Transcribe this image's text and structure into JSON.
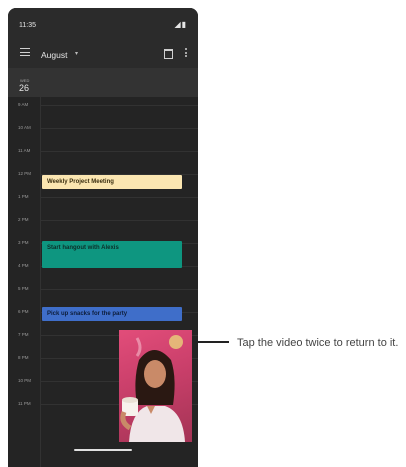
{
  "status_bar": {
    "time": "11:35",
    "icons": "◢▮"
  },
  "app_bar": {
    "month": "August",
    "caret": "▾"
  },
  "day_header": {
    "day_name": "WED",
    "day_number": "26"
  },
  "hours": [
    "9 AM",
    "10 AM",
    "11 AM",
    "12 PM",
    "1 PM",
    "2 PM",
    "3 PM",
    "4 PM",
    "5 PM",
    "6 PM",
    "7 PM",
    "8 PM",
    "10 PM",
    "11 PM"
  ],
  "events": [
    {
      "title": "Weekly Project Meeting",
      "color": "#fbe6b1",
      "text_color": "#3b2f10"
    },
    {
      "title": "Start hangout with Alexis",
      "color": "#0e9680",
      "text_color": "#0b2f29"
    },
    {
      "title": "Pick up snacks for the party",
      "color": "#3f6ec9",
      "text_color": "#0d1d3a"
    }
  ],
  "callout": {
    "text": "Tap the video twice to return to it."
  },
  "icons": {
    "menu": "hamburger-icon",
    "calendar": "calendar-today-icon",
    "more": "more-vert-icon"
  }
}
